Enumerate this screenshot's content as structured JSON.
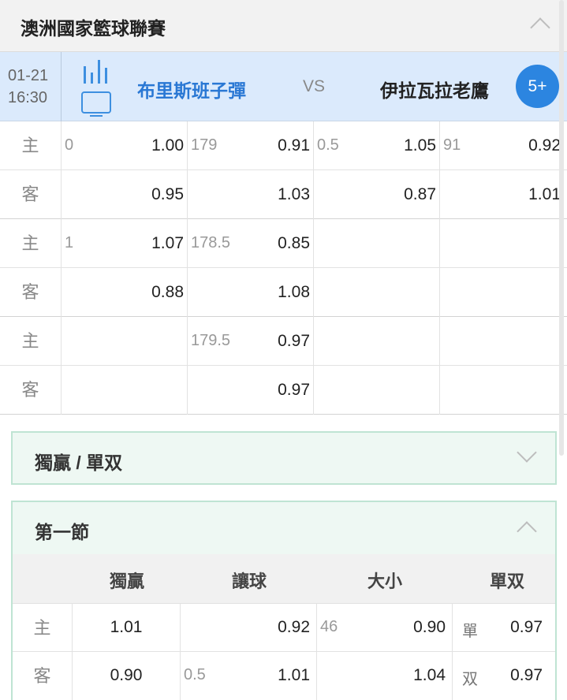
{
  "league": {
    "title": "澳洲國家籃球聯賽"
  },
  "match": {
    "date": "01-21",
    "time": "16:30",
    "home_team": "布里斯班子彈",
    "vs": "VS",
    "away_team": "伊拉瓦拉老鷹",
    "more_badge": "5+"
  },
  "side_labels": {
    "home": "主",
    "away": "客"
  },
  "odds_groups": [
    {
      "home": [
        {
          "line": "0",
          "odds": "1.00"
        },
        {
          "line": "179",
          "odds": "0.91"
        },
        {
          "line": "0.5",
          "odds": "1.05"
        },
        {
          "line": "91",
          "odds": "0.92"
        }
      ],
      "away": [
        {
          "line": "",
          "odds": "0.95"
        },
        {
          "line": "",
          "odds": "1.03"
        },
        {
          "line": "",
          "odds": "0.87"
        },
        {
          "line": "",
          "odds": "1.01"
        }
      ]
    },
    {
      "home": [
        {
          "line": "1",
          "odds": "1.07"
        },
        {
          "line": "178.5",
          "odds": "0.85"
        },
        {
          "line": "",
          "odds": ""
        },
        {
          "line": "",
          "odds": ""
        }
      ],
      "away": [
        {
          "line": "",
          "odds": "0.88"
        },
        {
          "line": "",
          "odds": "1.08"
        },
        {
          "line": "",
          "odds": ""
        },
        {
          "line": "",
          "odds": ""
        }
      ]
    },
    {
      "home": [
        {
          "line": "",
          "odds": ""
        },
        {
          "line": "179.5",
          "odds": "0.97"
        },
        {
          "line": "",
          "odds": ""
        },
        {
          "line": "",
          "odds": ""
        }
      ],
      "away": [
        {
          "line": "",
          "odds": ""
        },
        {
          "line": "",
          "odds": "0.97"
        },
        {
          "line": "",
          "odds": ""
        },
        {
          "line": "",
          "odds": ""
        }
      ]
    }
  ],
  "sections": {
    "moneyline_oddeven": {
      "title": "獨贏 / 單双",
      "expanded": false
    },
    "first_quarter": {
      "title": "第一節",
      "expanded": true,
      "headers": [
        "獨贏",
        "讓球",
        "大小",
        "單双"
      ],
      "home": {
        "moneyline": "1.01",
        "handicap_line": "",
        "handicap_odds": "0.92",
        "total_line": "46",
        "total_odds": "0.90",
        "oddeven_label": "單",
        "oddeven_odds": "0.97"
      },
      "away": {
        "moneyline": "0.90",
        "handicap_line": "0.5",
        "handicap_odds": "1.01",
        "total_line": "",
        "total_odds": "1.04",
        "oddeven_label": "双",
        "oddeven_odds": "0.97"
      }
    }
  },
  "icons": {
    "stats": "bar-chart-icon",
    "tv": "tv-icon",
    "collapse": "chevron-up-icon",
    "expand": "chevron-down-icon"
  },
  "colors": {
    "accent_blue": "#2a78d4",
    "match_row_bg": "#dbeafc",
    "section_border": "#bfe4d3",
    "badge_bg": "#2c85e0"
  }
}
